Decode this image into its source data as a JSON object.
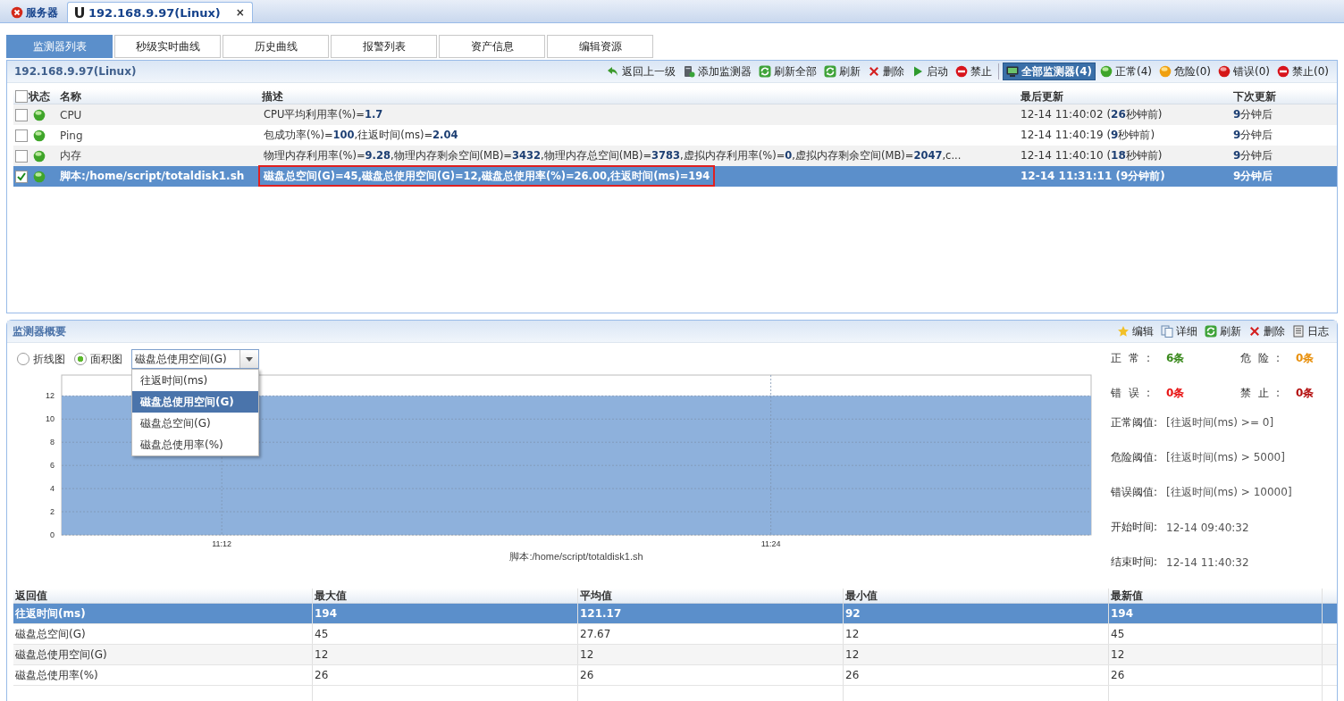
{
  "window_tabs": [
    {
      "label": "服务器",
      "selected": false,
      "kind": "server"
    },
    {
      "label": "192.168.9.97(Linux)",
      "selected": true,
      "kind": "host",
      "logo": "U",
      "close": "×"
    }
  ],
  "tabs": [
    {
      "label": "监测器列表",
      "selected": true
    },
    {
      "label": "秒级实时曲线",
      "selected": false
    },
    {
      "label": "历史曲线",
      "selected": false
    },
    {
      "label": "报警列表",
      "selected": false
    },
    {
      "label": "资产信息",
      "selected": false
    },
    {
      "label": "编辑资源",
      "selected": false
    }
  ],
  "monitor_panel": {
    "title": "192.168.9.97(Linux)",
    "toolbar": [
      {
        "label": "返回上一级",
        "kind": "back"
      },
      {
        "label": "添加监测器",
        "kind": "add"
      },
      {
        "label": "刷新全部",
        "kind": "refresh"
      },
      {
        "label": "刷新",
        "kind": "refresh"
      },
      {
        "label": "删除",
        "kind": "delete"
      },
      {
        "label": "启动",
        "kind": "start"
      },
      {
        "label": "禁止",
        "kind": "forbid"
      }
    ],
    "filters": [
      {
        "label": "全部监测器(4)",
        "kind": "monitor",
        "selected": true
      },
      {
        "label": "正常(4)",
        "kind": "ok",
        "selected": false
      },
      {
        "label": "危险(0)",
        "kind": "warn",
        "selected": false
      },
      {
        "label": "错误(0)",
        "kind": "error",
        "selected": false
      },
      {
        "label": "禁止(0)",
        "kind": "forbid",
        "selected": false
      }
    ],
    "table": {
      "all_checked": false,
      "columns": [
        "状态",
        "名称",
        "描述",
        "最后更新",
        "下次更新"
      ],
      "rows": [
        {
          "checked": false,
          "selected": false,
          "highlighted": false,
          "name": "CPU",
          "description": "CPU平均利用率(%)=**1.7**",
          "last_update": "12-14 11:40:02 (**26**秒钟前)",
          "next_update": "**9**分钟后"
        },
        {
          "checked": false,
          "selected": false,
          "highlighted": false,
          "name": "Ping",
          "description": "包成功率(%)=**100**,往返时间(ms)=**2.04**",
          "last_update": "12-14 11:40:19 (**9**秒钟前)",
          "next_update": "**9**分钟后"
        },
        {
          "checked": false,
          "selected": false,
          "highlighted": false,
          "name": "内存",
          "description": "物理内存利用率(%)=**9.28**,物理内存剩余空间(MB)=**3432**,物理内存总空间(MB)=**3783**,虚拟内存利用率(%)=**0**,虚拟内存剩余空间(MB)=**2047**,c...",
          "last_update": "12-14 11:40:10 (**18**秒钟前)",
          "next_update": "**9**分钟后"
        },
        {
          "checked": true,
          "selected": true,
          "highlighted": true,
          "name": "脚本:/home/script/totaldisk1.sh",
          "description": "磁盘总空间(G)=45,磁盘总使用空间(G)=12,磁盘总使用率(%)=26.00,往返时间(ms)=194",
          "last_update": "12-14 11:31:11 (9分钟前)",
          "next_update": "9分钟后"
        }
      ]
    }
  },
  "summary_panel": {
    "title": "监测器概要",
    "actions": [
      {
        "label": "编辑",
        "kind": "edit"
      },
      {
        "label": "详细",
        "kind": "detail"
      },
      {
        "label": "刷新",
        "kind": "refresh"
      },
      {
        "label": "删除",
        "kind": "delete"
      },
      {
        "label": "日志",
        "kind": "log"
      }
    ],
    "chart_types": [
      {
        "label": "折线图",
        "selected": false
      },
      {
        "label": "面积图",
        "selected": true
      }
    ],
    "metric_select": {
      "value": "磁盘总使用空间(G)",
      "expanded": true,
      "options": [
        {
          "label": "往返时间(ms)",
          "selected": false
        },
        {
          "label": "磁盘总使用空间(G)",
          "selected": true
        },
        {
          "label": "磁盘总空间(G)",
          "selected": false
        },
        {
          "label": "磁盘总使用率(%)",
          "selected": false
        }
      ]
    },
    "chart_data": {
      "type": "area",
      "xlabel": "脚本:/home/script/totaldisk1.sh",
      "categories": [
        null,
        null,
        null,
        null,
        null,
        null,
        null,
        "11:12",
        null,
        null,
        null,
        null,
        null,
        null,
        null,
        null,
        null,
        null,
        null,
        null,
        null,
        null,
        null,
        null,
        null,
        null,
        null,
        null,
        null,
        null,
        null,
        "11:24",
        null,
        null,
        null,
        null,
        null,
        null,
        null,
        null,
        null,
        null,
        null,
        null,
        null,
        null
      ],
      "series": [
        {
          "color": "#8eb1dc",
          "values": [
            12,
            12,
            12,
            12,
            12,
            12,
            12,
            12,
            12,
            12,
            12,
            12,
            12,
            12,
            12,
            12,
            12,
            12,
            12,
            12,
            12,
            12,
            12,
            12,
            12,
            12,
            12,
            12,
            12,
            12,
            12,
            12,
            12,
            12,
            12,
            12,
            12,
            12,
            12,
            12,
            12,
            12,
            12,
            12,
            12,
            12
          ]
        }
      ],
      "ylim": [
        0,
        13.8
      ],
      "grid": true,
      "yticks": [
        0,
        2,
        4,
        6,
        8,
        10,
        12
      ]
    },
    "counts": [
      {
        "label": "正常:",
        "value": "6条",
        "color": "#3b8a1e"
      },
      {
        "label": "危险:",
        "value": "0条",
        "color": "#e8900c"
      },
      {
        "label": "错误:",
        "value": "0条",
        "color": "#e81414"
      },
      {
        "label": "禁止:",
        "value": "0条",
        "color": "#b41010"
      }
    ],
    "info": [
      {
        "label": "正常阈值:",
        "value": "[往返时间(ms) >= 0]"
      },
      {
        "label": "危险阈值:",
        "value": "[往返时间(ms) > 5000]"
      },
      {
        "label": "错误阈值:",
        "value": "[往返时间(ms) > 10000]"
      },
      {
        "label": "开始时间:",
        "value": "12-14 09:40:32"
      },
      {
        "label": "结束时间:",
        "value": "12-14 11:40:32"
      }
    ],
    "values_table": {
      "columns": [
        "返回值",
        "最大值",
        "平均值",
        "最小值",
        "最新值"
      ],
      "rows": [
        {
          "selected": true,
          "cells": [
            "往返时间(ms)",
            "194",
            "121.17",
            "92",
            "194"
          ]
        },
        {
          "selected": false,
          "cells": [
            "磁盘总空间(G)",
            "45",
            "27.67",
            "12",
            "45"
          ]
        },
        {
          "selected": false,
          "cells": [
            "磁盘总使用空间(G)",
            "12",
            "12",
            "12",
            "12"
          ]
        },
        {
          "selected": false,
          "cells": [
            "磁盘总使用率(%)",
            "26",
            "26",
            "26",
            "26"
          ]
        }
      ]
    }
  }
}
